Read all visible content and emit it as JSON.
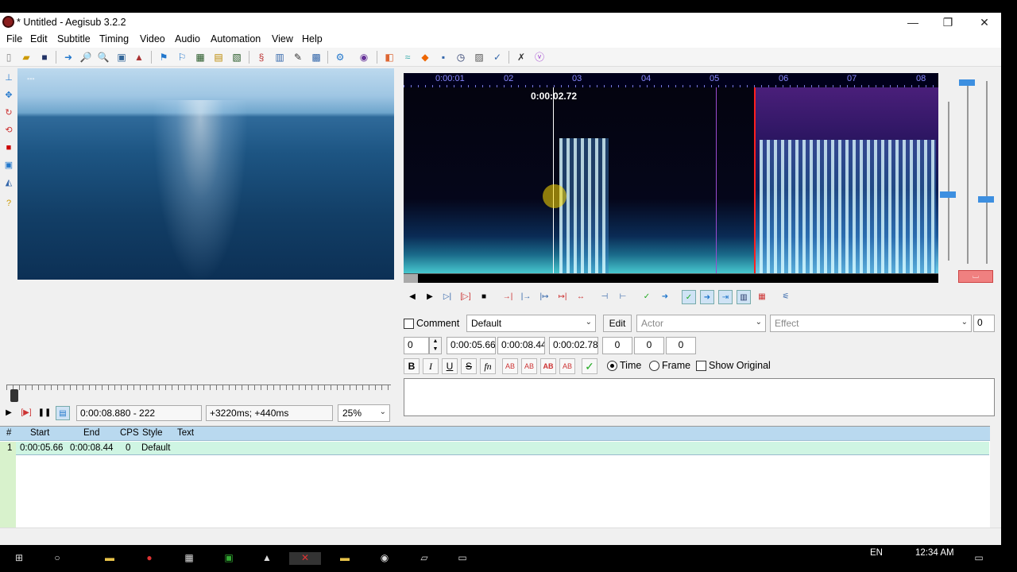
{
  "window": {
    "title": "* Untitled - Aegisub 3.2.2",
    "minimize": "—",
    "restore": "❐",
    "close": "✕"
  },
  "menu": [
    "File",
    "Edit",
    "Subtitle",
    "Timing",
    "Video",
    "Audio",
    "Automation",
    "View",
    "Help"
  ],
  "video_controls": {
    "time_field": "0:00:08.880 - 222",
    "offset_field": "+3220ms; +440ms",
    "zoom": "25%"
  },
  "audio": {
    "ruler_labels": [
      "0:00:01",
      "02",
      "03",
      "04",
      "05",
      "06",
      "07",
      "08"
    ],
    "cursor_time": "0:00:02.72"
  },
  "edit": {
    "comment_label": "Comment",
    "style": "Default",
    "edit_button": "Edit",
    "actor_placeholder": "Actor",
    "effect_placeholder": "Effect",
    "effect_count": "0",
    "layer": "0",
    "start": "0:00:05.66",
    "end": "0:00:08.44",
    "duration": "0:00:02.78",
    "margin_l": "0",
    "margin_r": "0",
    "margin_v": "0",
    "bold": "B",
    "italic": "I",
    "underline": "U",
    "strike": "S",
    "fn": "fn",
    "time_label": "Time",
    "frame_label": "Frame",
    "show_original_label": "Show Original",
    "text": ""
  },
  "grid": {
    "headers": [
      "#",
      "Start",
      "End",
      "CPS",
      "Style",
      "Text"
    ],
    "rows": [
      {
        "num": "1",
        "start": "0:00:05.66",
        "end": "0:00:08.44",
        "cps": "0",
        "style": "Default",
        "text": ""
      }
    ]
  },
  "taskbar": {
    "lang": "EN",
    "clock": "12:34 AM"
  },
  "colors": {
    "accent": "#3d8fe0",
    "grid_header": "#b9d9ef",
    "row_highlight": "#cff5e3",
    "audio_selection_start": "#ff2020"
  }
}
